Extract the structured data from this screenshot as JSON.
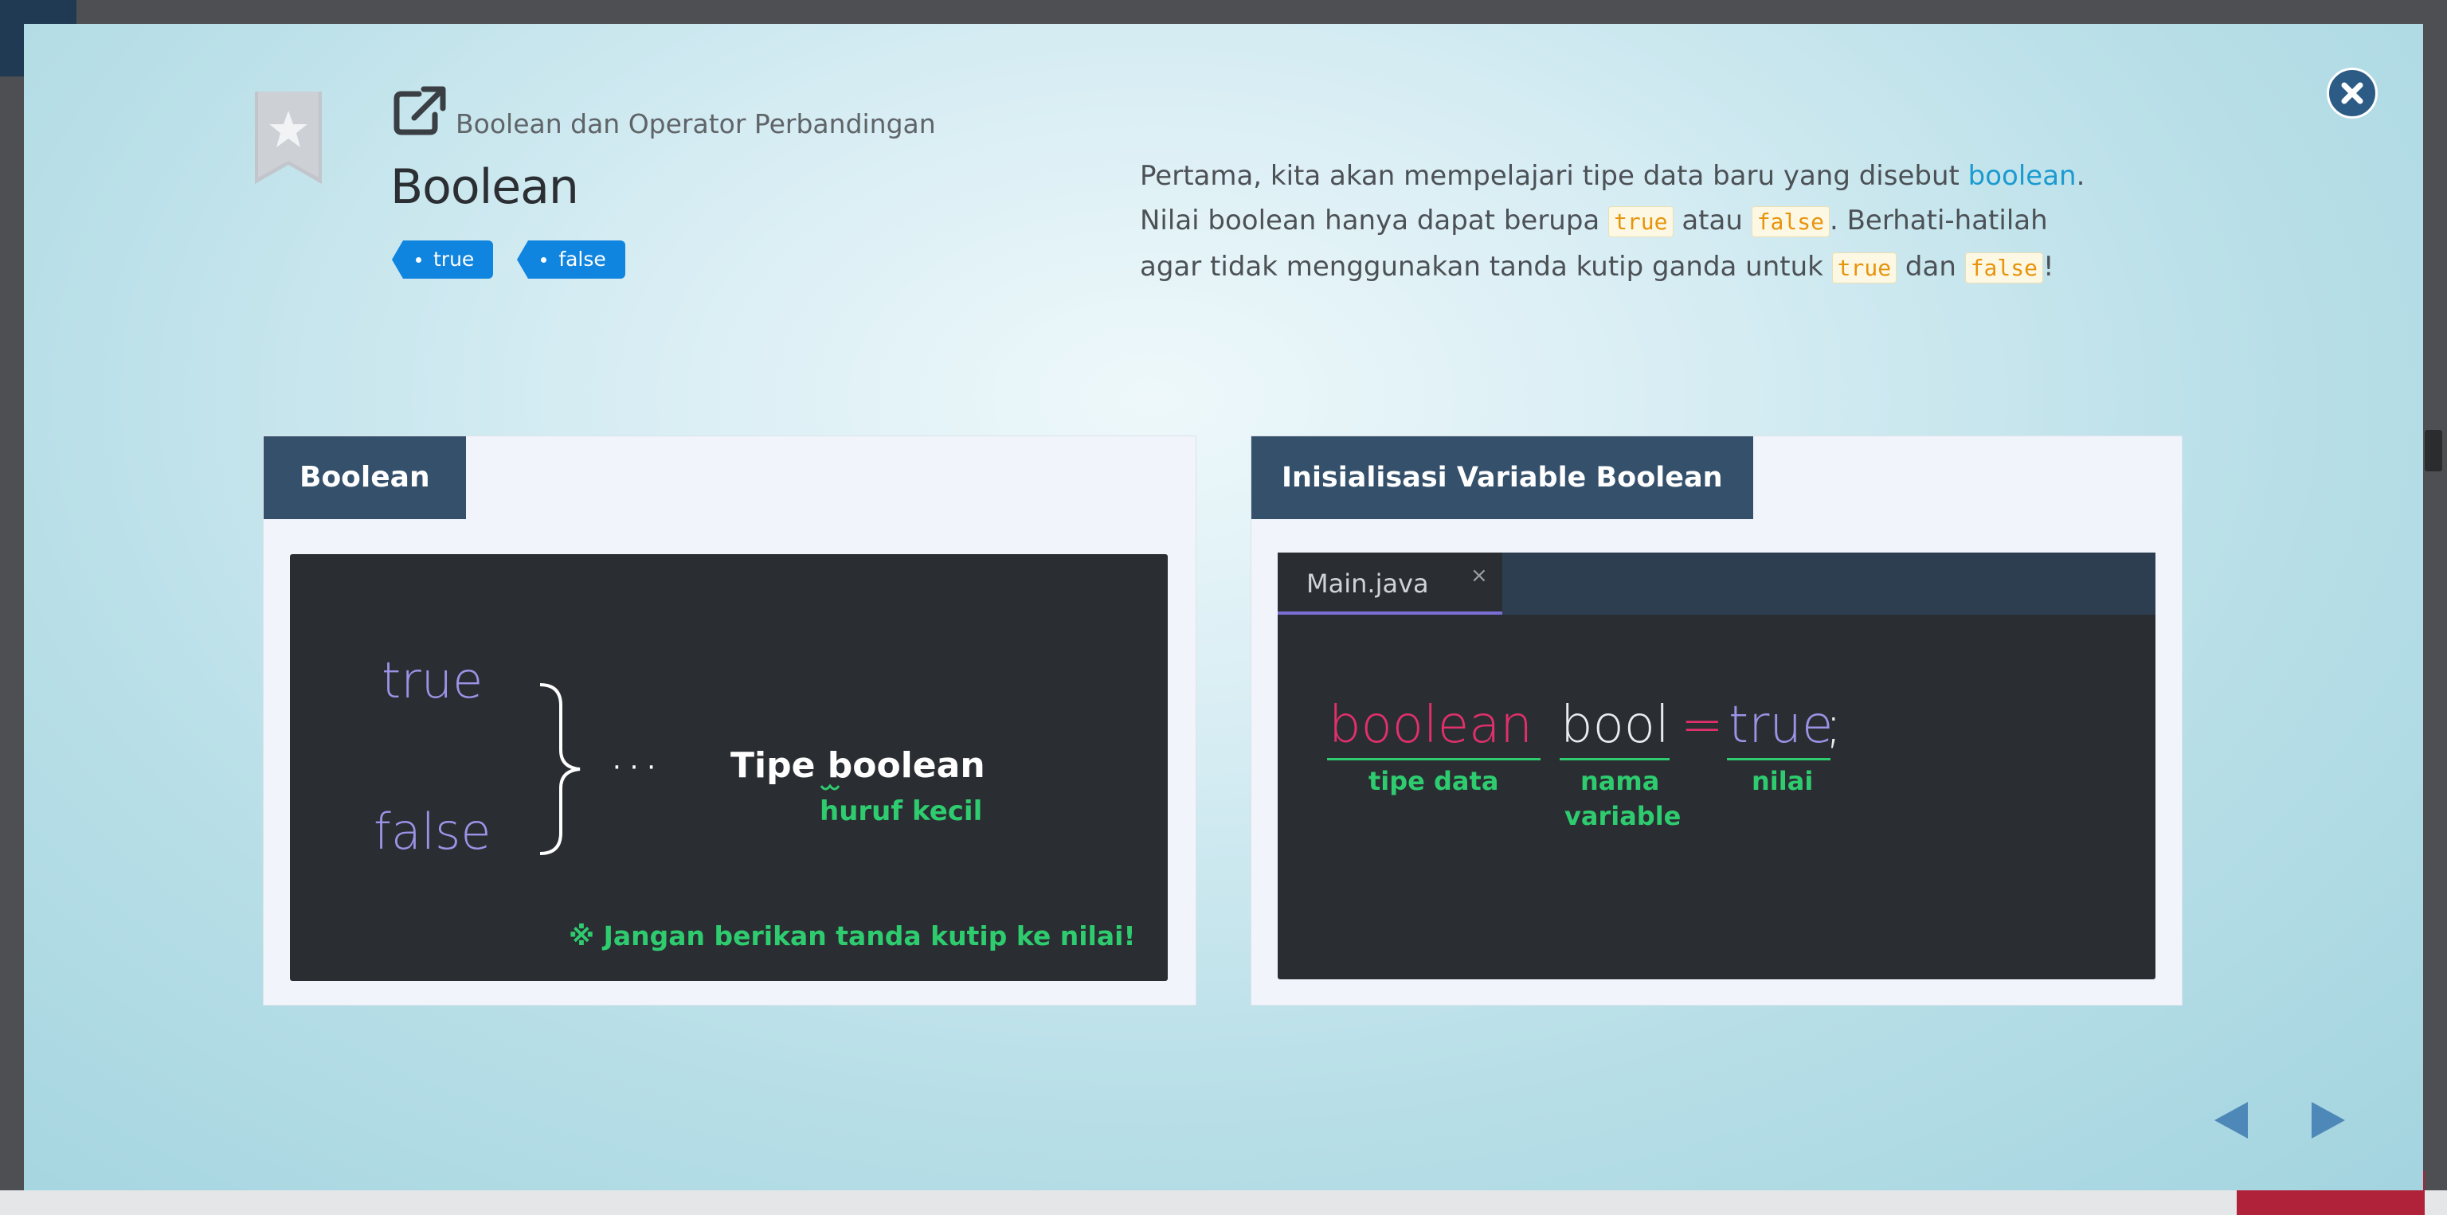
{
  "modal": {
    "breadcrumb": "Boolean dan Operator Perbandingan",
    "title": "Boolean",
    "tags": [
      "true",
      "false"
    ],
    "description": {
      "p1": "Pertama, kita akan mempelajari tipe data baru yang disebut ",
      "link": "boolean",
      "p2": ".",
      "p3": "Nilai boolean hanya dapat berupa ",
      "code_true": "true",
      "p4": " atau ",
      "code_false": "false",
      "p5": ". Berhati-hatilah",
      "p6": "agar tidak menggunakan tanda kutip ganda untuk ",
      "p7": " dan ",
      "p8": "!"
    }
  },
  "card_boolean": {
    "header": "Boolean",
    "slide": {
      "value_true": "true",
      "value_false": "false",
      "dots": "· · ·",
      "type_prefix": "Tipe ",
      "type_word": "boolean",
      "note_lowercase": "huruf kecil",
      "warning": "※ Jangan berikan tanda kutip ke nilai!"
    }
  },
  "card_init": {
    "header": "Inisialisasi Variable Boolean",
    "editor": {
      "tab_label": "Main.java",
      "tab_close": "×",
      "code_type": "boolean",
      "code_name": "bool",
      "code_eq": "=",
      "code_value": "true",
      "code_semicolon": ";",
      "label_type": "tipe data",
      "label_name_1": "nama",
      "label_name_2": "variable",
      "label_value": "nilai"
    }
  },
  "icons": {
    "bookmark": "bookmark-star-icon",
    "external": "external-link-icon",
    "close": "close-icon",
    "prev": "triangle-left-icon",
    "next": "triangle-right-icon"
  },
  "colors": {
    "tag_blue": "#1085e0",
    "header_navy": "#35506b",
    "code_pink": "#e3306b",
    "code_purple": "#9c93e6",
    "note_green": "#2ecc6f",
    "link_blue": "#1b9bd0",
    "inline_code_orange": "#e8940b"
  }
}
